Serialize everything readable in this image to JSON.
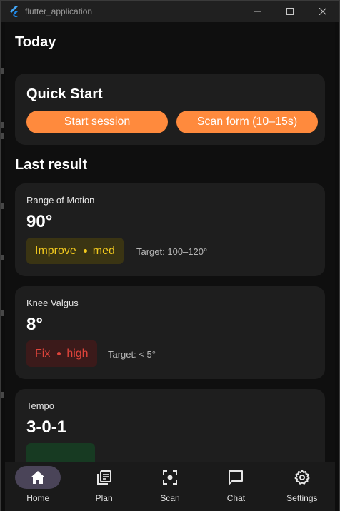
{
  "window": {
    "title": "flutter_application",
    "controls": {
      "minimize": "—",
      "maximize": "☐",
      "close": "✕"
    }
  },
  "today_heading": "Today",
  "quick_start": {
    "title": "Quick Start",
    "start_label": "Start session",
    "scan_label": "Scan form (10–15s)"
  },
  "last_result_heading": "Last result",
  "results": [
    {
      "label": "Range of Motion",
      "value": "90°",
      "status": "Improve",
      "severity": "med",
      "target": "Target: 100–120°",
      "status_color": "#f2c91e"
    },
    {
      "label": "Knee Valgus",
      "value": "8°",
      "status": "Fix",
      "severity": "high",
      "target": "Target: < 5°",
      "status_color": "#e0443b"
    },
    {
      "label": "Tempo",
      "value": "3-0-1"
    }
  ],
  "nav": [
    {
      "label": "Home",
      "icon": "home-icon",
      "active": true
    },
    {
      "label": "Plan",
      "icon": "plan-icon",
      "active": false
    },
    {
      "label": "Scan",
      "icon": "scan-icon",
      "active": false
    },
    {
      "label": "Chat",
      "icon": "chat-icon",
      "active": false
    },
    {
      "label": "Settings",
      "icon": "settings-icon",
      "active": false
    }
  ],
  "colors": {
    "accent": "#ff8a3d",
    "background": "#0f0f0f",
    "card": "#1e1e1e",
    "nav_active": "#4a4458"
  }
}
